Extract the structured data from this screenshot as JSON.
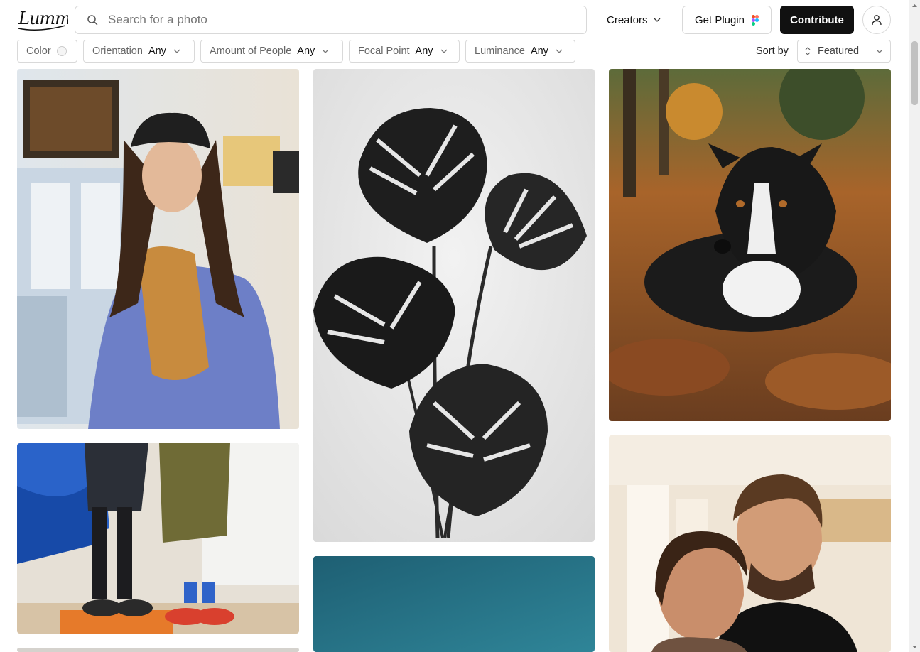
{
  "header": {
    "logo_text": "Lummi",
    "search_placeholder": "Search for a photo",
    "creators_label": "Creators",
    "plugin_label": "Get Plugin",
    "contribute_label": "Contribute"
  },
  "filters": {
    "color_label": "Color",
    "orientation": {
      "label": "Orientation",
      "value": "Any"
    },
    "people": {
      "label": "Amount of People",
      "value": "Any"
    },
    "focal": {
      "label": "Focal Point",
      "value": "Any"
    },
    "luminance": {
      "label": "Luminance",
      "value": "Any"
    }
  },
  "sort": {
    "label": "Sort by",
    "value": "Featured"
  },
  "colors": {
    "brand_dark": "#111111",
    "border": "#d9d9d9",
    "teal_photo": "#2a7a8c"
  },
  "photos": [
    {
      "name": "girl-in-hoodie-photo"
    },
    {
      "name": "monstera-leaves-photo"
    },
    {
      "name": "border-collie-autumn-photo"
    },
    {
      "name": "two-people-boots-photo"
    },
    {
      "name": "teal-gradient-photo"
    },
    {
      "name": "couple-portrait-photo"
    }
  ]
}
